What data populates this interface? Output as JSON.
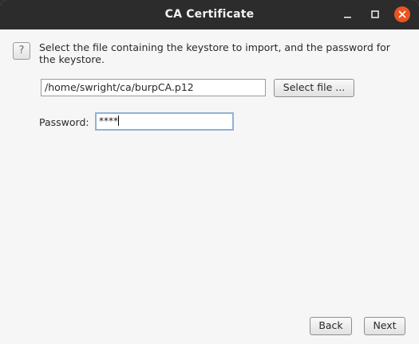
{
  "window": {
    "title": "CA Certificate",
    "accent_close_color": "#e95420",
    "controls": [
      "minimize-icon",
      "maximize-icon",
      "close-icon"
    ]
  },
  "dialog": {
    "help_icon": "?",
    "instructions": "Select the file containing the keystore to import, and the password for the keystore.",
    "file_path": "/home/swright/ca/burpCA.p12",
    "select_file_label": "Select file ...",
    "password_label": "Password:",
    "password_value": "****"
  },
  "footer": {
    "back_label": "Back",
    "next_label": "Next"
  }
}
